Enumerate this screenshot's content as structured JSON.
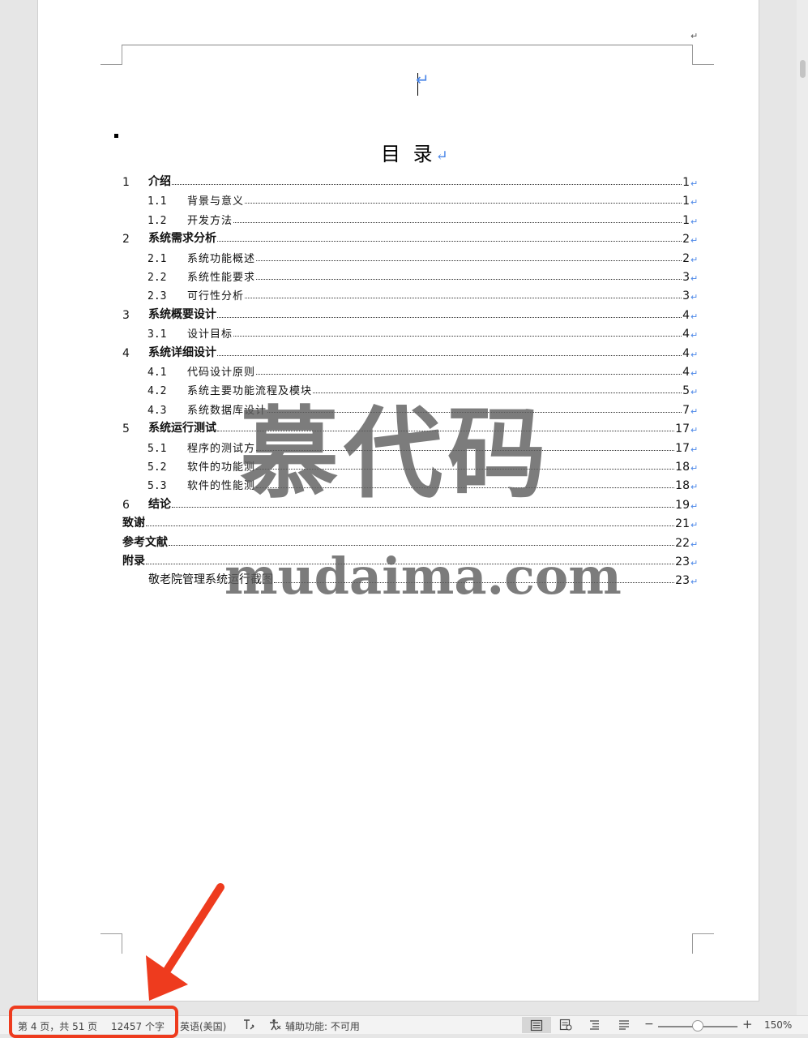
{
  "document": {
    "header_return_mark": "↵",
    "cursor_return_mark": "↵",
    "toc_title": "目 录",
    "toc_title_mark": "↵",
    "return_mark": "↵",
    "toc": [
      {
        "num": "1",
        "label": "介绍",
        "page": "1",
        "level": 1
      },
      {
        "num": "1.1",
        "label": "背景与意义",
        "page": "1",
        "level": 2
      },
      {
        "num": "1.2",
        "label": "开发方法",
        "page": "1",
        "level": 2
      },
      {
        "num": "2",
        "label": "系统需求分析",
        "page": "2",
        "level": 1
      },
      {
        "num": "2.1",
        "label": "系统功能概述",
        "page": "2",
        "level": 2
      },
      {
        "num": "2.2",
        "label": "系统性能要求",
        "page": "3",
        "level": 2
      },
      {
        "num": "2.3",
        "label": "可行性分析",
        "page": "3",
        "level": 2
      },
      {
        "num": "3",
        "label": "系统概要设计",
        "page": "4",
        "level": 1
      },
      {
        "num": "3.1",
        "label": "设计目标",
        "page": "4",
        "level": 2
      },
      {
        "num": "4",
        "label": "系统详细设计",
        "page": "4",
        "level": 1
      },
      {
        "num": "4.1",
        "label": "代码设计原则",
        "page": "4",
        "level": 2
      },
      {
        "num": "4.2",
        "label": "系统主要功能流程及模块",
        "page": "5",
        "level": 2
      },
      {
        "num": "4.3",
        "label": "系统数据库设计",
        "page": "7",
        "level": 2
      },
      {
        "num": "5",
        "label": "系统运行测试",
        "page": "17",
        "level": 1
      },
      {
        "num": "5.1",
        "label": "程序的测试方",
        "page": "17",
        "level": 2
      },
      {
        "num": "5.2",
        "label": "软件的功能测",
        "page": "18",
        "level": 2
      },
      {
        "num": "5.3",
        "label": "软件的性能测",
        "page": "18",
        "level": 2
      },
      {
        "num": "6",
        "label": "结论",
        "page": "19",
        "level": 1
      },
      {
        "num": "",
        "label": "致谢",
        "page": "21",
        "level": 0
      },
      {
        "num": "",
        "label": "参考文献",
        "page": "22",
        "level": 0
      },
      {
        "num": "",
        "label": "附录",
        "page": "23",
        "level": 0
      },
      {
        "num": "",
        "label": "敬老院管理系统运行截图",
        "page": "23",
        "level": 3
      }
    ]
  },
  "watermark": {
    "chinese": "慕代码",
    "english": "mudaima.com"
  },
  "annotation": {
    "arrow_color": "#ee3b1e",
    "highlight_color": "#ee3b1e"
  },
  "statusbar": {
    "page_info": "第 4 页，共 51 页",
    "word_count": "12457 个字",
    "language": "英语(美国)",
    "accessibility": "辅助功能: 不可用",
    "zoom_level": "150%",
    "zoom_out": "−",
    "zoom_in": "+",
    "zoom_fraction": 0.5,
    "icons": [
      "track-changes-icon",
      "accessibility-icon",
      "print-layout-icon",
      "web-layout-icon",
      "outline-icon",
      "draft-icon"
    ]
  }
}
